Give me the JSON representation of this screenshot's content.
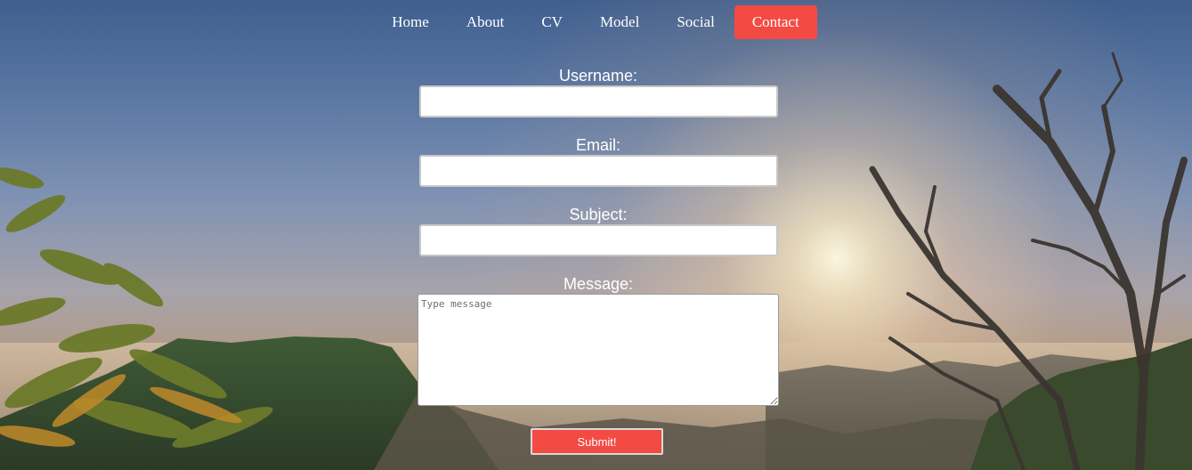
{
  "nav": {
    "items": [
      {
        "label": "Home"
      },
      {
        "label": "About"
      },
      {
        "label": "CV"
      },
      {
        "label": "Model"
      },
      {
        "label": "Social"
      },
      {
        "label": "Contact"
      }
    ],
    "active_color": "#f44a44"
  },
  "form": {
    "username_label": "Username:",
    "email_label": "Email:",
    "subject_label": "Subject:",
    "message_label": "Message:",
    "username_value": "",
    "email_value": "",
    "subject_value": "",
    "message_placeholder": "Type message",
    "submit_label": "Submit!"
  },
  "colors": {
    "accent": "#f44a44",
    "text": "#ffffff"
  }
}
